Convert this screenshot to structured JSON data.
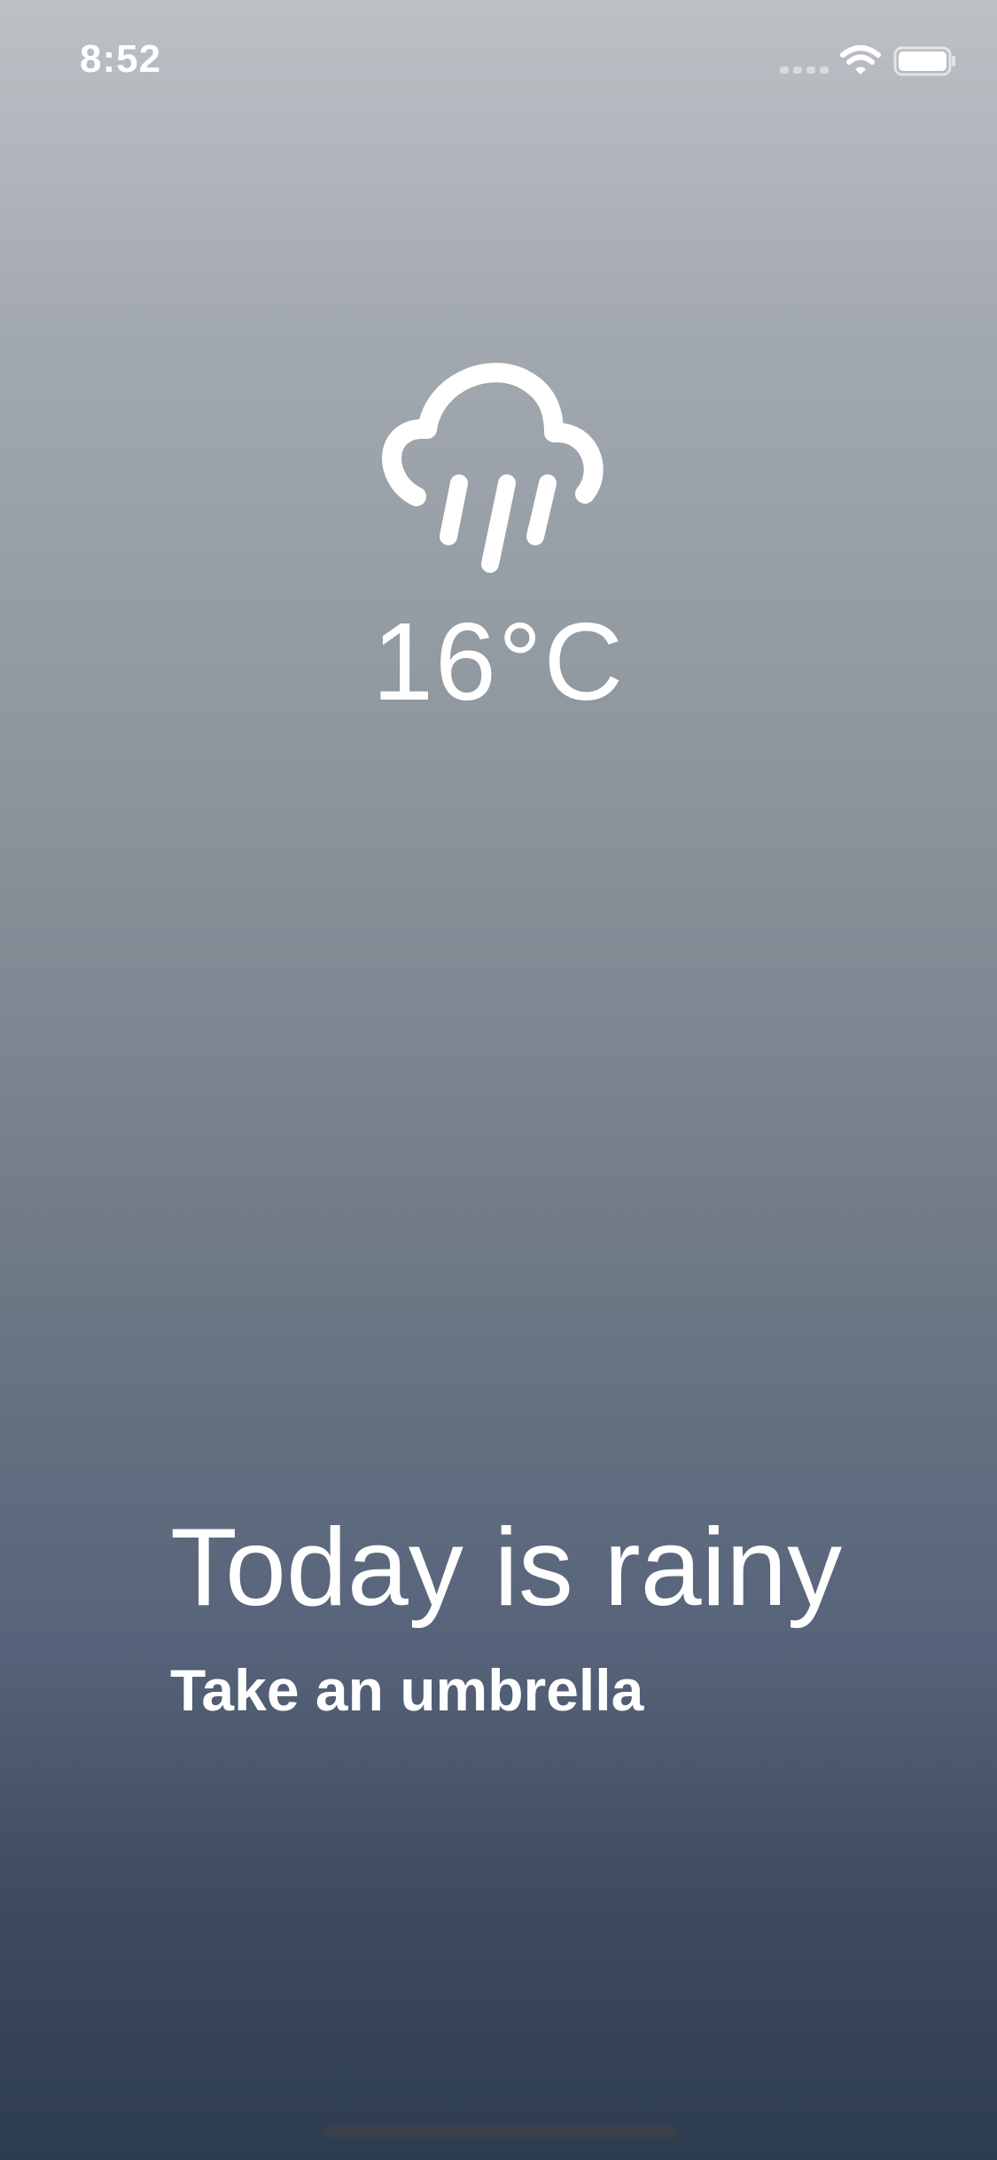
{
  "status_bar": {
    "time": "8:52"
  },
  "weather": {
    "icon": "cloud-rain-icon",
    "temperature": "16°C"
  },
  "message": {
    "headline": "Today is rainy",
    "subline": "Take an umbrella"
  },
  "colors": {
    "background_top": "#bcc1c6",
    "background_bottom": "#2e3c50",
    "text": "#ffffff"
  }
}
